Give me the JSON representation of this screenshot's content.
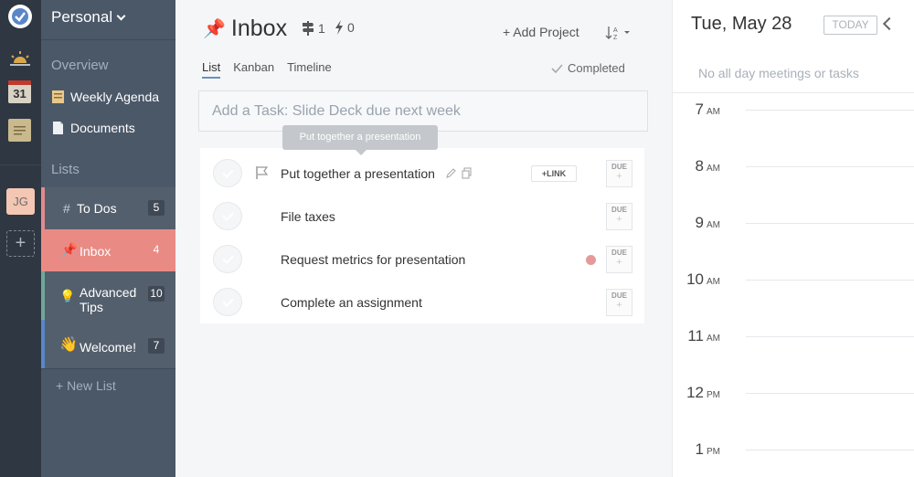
{
  "rail": {
    "calendar_day": "31",
    "avatar_initials": "JG",
    "add_label": "+"
  },
  "sidebar": {
    "space_title": "Personal",
    "overview_label": "Overview",
    "weekly_agenda": "Weekly Agenda",
    "documents": "Documents",
    "lists_label": "Lists",
    "lists": [
      {
        "name": "To Dos",
        "count": "5",
        "icon": "#"
      },
      {
        "name": "Inbox",
        "count": "4",
        "icon": "📌"
      },
      {
        "name": "Advanced Tips",
        "count": "10",
        "icon": "💡"
      },
      {
        "name": "Welcome!",
        "count": "7",
        "icon": "👋"
      }
    ],
    "new_list": "+ New List"
  },
  "main": {
    "title": "Inbox",
    "title_icon": "📌",
    "subtask_count": "1",
    "bolt_count": "0",
    "add_project": "+ Add Project",
    "sort_label": "A Z",
    "tabs": [
      "List",
      "Kanban",
      "Timeline"
    ],
    "completed": "Completed",
    "add_task_placeholder": "Add a Task: Slide Deck due next week",
    "tooltip": "Put together a presentation",
    "link_label": "+LINK",
    "due_label": "DUE",
    "due_plus": "+",
    "tasks": [
      {
        "text": "Put together a presentation"
      },
      {
        "text": "File taxes"
      },
      {
        "text": "Request metrics for presentation"
      },
      {
        "text": "Complete an assignment"
      }
    ]
  },
  "calendar": {
    "date": "Tue, May 28",
    "today": "TODAY",
    "no_events": "No all day meetings or tasks",
    "hours": [
      {
        "h": "7",
        "ap": "AM"
      },
      {
        "h": "8",
        "ap": "AM"
      },
      {
        "h": "9",
        "ap": "AM"
      },
      {
        "h": "10",
        "ap": "AM"
      },
      {
        "h": "11",
        "ap": "AM"
      },
      {
        "h": "12",
        "ap": "PM"
      },
      {
        "h": "1",
        "ap": "PM"
      }
    ]
  },
  "colors": {
    "rail_bg": "#2f3742",
    "sidebar_bg": "#4b5868",
    "inbox_active": "#e98b84",
    "todos_accent": "#e08c8c",
    "tips_accent": "#6fa89a",
    "welcome_accent": "#5a86c8"
  }
}
